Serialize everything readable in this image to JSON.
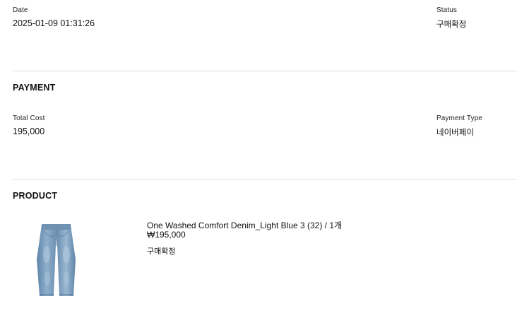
{
  "order": {
    "date_label": "Date",
    "date_value": "2025-01-09 01:31:26",
    "status_label": "Status",
    "status_value": "구매확정"
  },
  "payment": {
    "title": "PAYMENT",
    "total_label": "Total Cost",
    "total_value": "195,000",
    "type_label": "Payment Type",
    "type_value": "네이버페이"
  },
  "product": {
    "title": "PRODUCT",
    "name": "One Washed Comfort Denim_Light Blue 3 (32) / 1개",
    "price": "₩195,000",
    "status": "구매확정",
    "thumbnail_icon": "jeans-product-image"
  }
}
